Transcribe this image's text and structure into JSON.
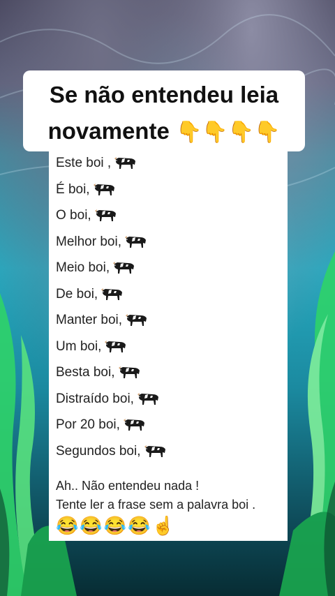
{
  "title": {
    "line1": "Se não entendeu leia",
    "line2": "novamente",
    "hands": "👇👇👇👇"
  },
  "lines": [
    {
      "text": "Este boi ,",
      "icon": "cow-icon"
    },
    {
      "text": "É boi,",
      "icon": "cow-icon"
    },
    {
      "text": "O boi,",
      "icon": "cow-icon"
    },
    {
      "text": "Melhor boi,",
      "icon": "cow-icon"
    },
    {
      "text": "Meio boi,",
      "icon": "cow-icon"
    },
    {
      "text": "De boi,",
      "icon": "cow-icon"
    },
    {
      "text": "Manter boi,",
      "icon": "cow-icon"
    },
    {
      "text": "Um boi,",
      "icon": "cow-icon"
    },
    {
      "text": "Besta boi,",
      "icon": "cow-icon"
    },
    {
      "text": "Distraído boi,",
      "icon": "cow-icon"
    },
    {
      "text": "Por 20 boi,",
      "icon": "cow-icon"
    },
    {
      "text": "Segundos boi,",
      "icon": "cow-icon"
    }
  ],
  "message": {
    "line1": "Ah.. Não entendeu nada !",
    "line2": "Tente ler a frase sem a palavra boi ."
  },
  "emojis": "😂😂😂😂☝️"
}
